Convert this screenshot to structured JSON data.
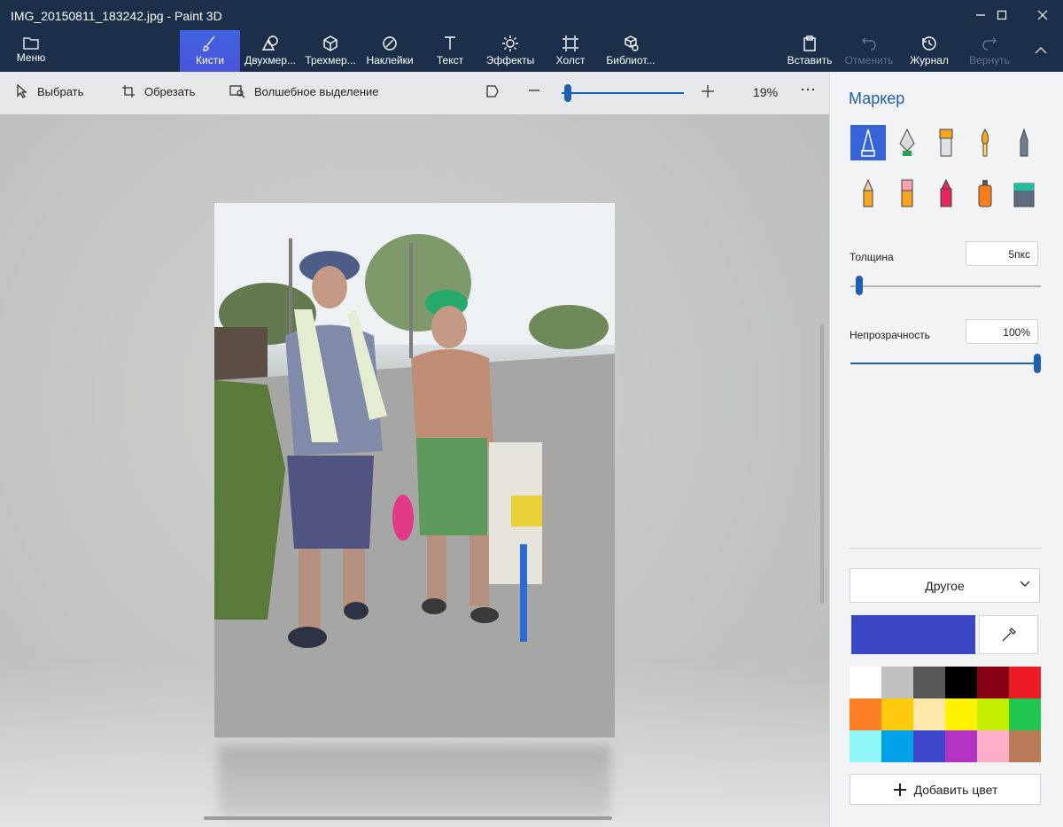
{
  "window": {
    "title": "IMG_20150811_183242.jpg - Paint 3D",
    "controls": [
      "minimize-icon",
      "maximize-icon",
      "close-icon"
    ]
  },
  "ribbon": {
    "menu_label": "Меню",
    "tools": [
      {
        "label": "Кисти",
        "icon": "brush-icon",
        "active": true
      },
      {
        "label": "Двухмер...",
        "icon": "2d-shapes-icon"
      },
      {
        "label": "Трехмер...",
        "icon": "3d-shapes-icon"
      },
      {
        "label": "Наклейки",
        "icon": "stickers-icon"
      },
      {
        "label": "Текст",
        "icon": "text-icon"
      },
      {
        "label": "Эффекты",
        "icon": "effects-icon"
      },
      {
        "label": "Холст",
        "icon": "canvas-icon"
      },
      {
        "label": "Библиот...",
        "icon": "library-icon"
      }
    ],
    "right_tools": [
      {
        "label": "Вставить",
        "icon": "paste-icon",
        "disabled": false
      },
      {
        "label": "Отменить",
        "icon": "undo-icon",
        "disabled": true
      },
      {
        "label": "Журнал",
        "icon": "history-icon",
        "disabled": false
      },
      {
        "label": "Вернуть",
        "icon": "redo-icon",
        "disabled": true
      }
    ]
  },
  "toolbar": {
    "select_label": "Выбрать",
    "crop_label": "Обрезать",
    "magic_select_label": "Волшебное выделение",
    "zoom_percent": "19%",
    "zoom_value": 0.02
  },
  "canvas": {
    "image_name": "photo-canvas"
  },
  "panel": {
    "title": "Маркер",
    "brushes": [
      "marker-icon",
      "calligraphy-pen-icon",
      "oil-brush-icon",
      "watercolor-icon",
      "pixel-pen-icon",
      "pencil-icon",
      "eraser-icon",
      "crayon-icon",
      "spray-can-icon",
      "fill-icon"
    ],
    "thickness_label": "Толщина",
    "thickness_value": "5пкс",
    "thickness_level": 0.03,
    "opacity_label": "Непрозрачность",
    "opacity_value": "100%",
    "opacity_level": 1.0,
    "color_mode": "Другое",
    "current_color": "#3a46c4",
    "palette": [
      "#ffffff",
      "#c0c0c0",
      "#585858",
      "#000000",
      "#880015",
      "#ed1c24",
      "#ff7f27",
      "#ffc90e",
      "#ffe8a8",
      "#fff200",
      "#c4f000",
      "#22c750",
      "#8ff7f7",
      "#00a2e8",
      "#3f48cc",
      "#b233c1",
      "#ffaec9",
      "#b97a57"
    ],
    "add_color_label": "Добавить цвет"
  }
}
